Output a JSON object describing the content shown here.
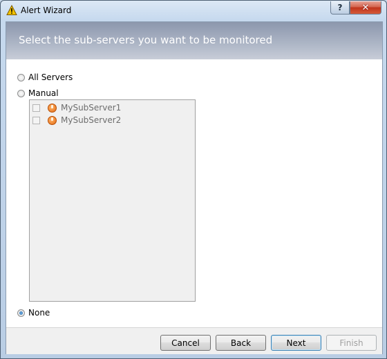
{
  "window": {
    "title": "Alert Wizard",
    "help_glyph": "?",
    "close_glyph": "✕"
  },
  "banner": {
    "text": "Select the sub-servers you want to be monitored"
  },
  "options": {
    "all_servers": "All Servers",
    "manual": "Manual",
    "none": "None",
    "selected": "None"
  },
  "servers": [
    {
      "label": "MySubServer1",
      "checked": false,
      "icon": "server-icon"
    },
    {
      "label": "MySubServer2",
      "checked": false,
      "icon": "server-icon"
    }
  ],
  "buttons": {
    "cancel": "Cancel",
    "back": "Back",
    "next": "Next",
    "finish": "Finish"
  },
  "icons": {
    "title": "warning-icon"
  },
  "colors": {
    "accent": "#3c7fb1",
    "server_icon": "#e36a10",
    "warning_icon": "#f2c200"
  }
}
